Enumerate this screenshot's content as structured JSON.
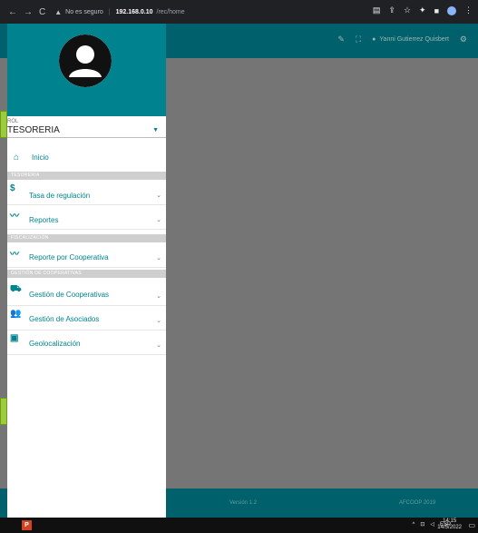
{
  "browser": {
    "nav_icons": [
      "←",
      "→",
      "C"
    ],
    "warning_icon": "warning-icon",
    "insecure_text": "No es seguro",
    "separator": "|",
    "host": "192.168.0.10",
    "path": "/rec/home",
    "right_icons": [
      "▤",
      "⇪",
      "☆",
      "✦",
      "■"
    ]
  },
  "topbar": {
    "icons": [
      "edit-icon",
      "fullscreen-icon"
    ],
    "user_name": "Yanni Gutierrez Quisbert",
    "settings_icon": "gear-icon"
  },
  "sidebar": {
    "rol_label": "ROL",
    "rol_value": "TESORERIA",
    "inicio_label": "Inicio",
    "sections": [
      {
        "title": "TESORERÍA"
      },
      {
        "title": "FISCALIZACIÓN"
      },
      {
        "title": "GESTIÓN DE COOPERATIVAS"
      }
    ],
    "items": [
      {
        "icon": "dollar-icon",
        "label": "Tasa de regulación"
      },
      {
        "icon": "trending-icon",
        "label": "Reportes"
      },
      {
        "icon": "trending-icon",
        "label": "Reporte por Cooperativa"
      },
      {
        "icon": "car-icon",
        "label": "Gestión de Cooperativas"
      },
      {
        "icon": "people-icon",
        "label": "Gestión de Asociados"
      },
      {
        "icon": "map-icon",
        "label": "Geolocalización"
      }
    ]
  },
  "footer": {
    "version": "Versión 1.2",
    "copyright": "AFCOOP 2019"
  },
  "taskbar": {
    "language": "ESP",
    "time": "14:15",
    "date": "14/5/2022"
  },
  "colors": {
    "teal_header": "#00838f",
    "teal_bar": "#00606b",
    "content_bg": "#757575"
  }
}
